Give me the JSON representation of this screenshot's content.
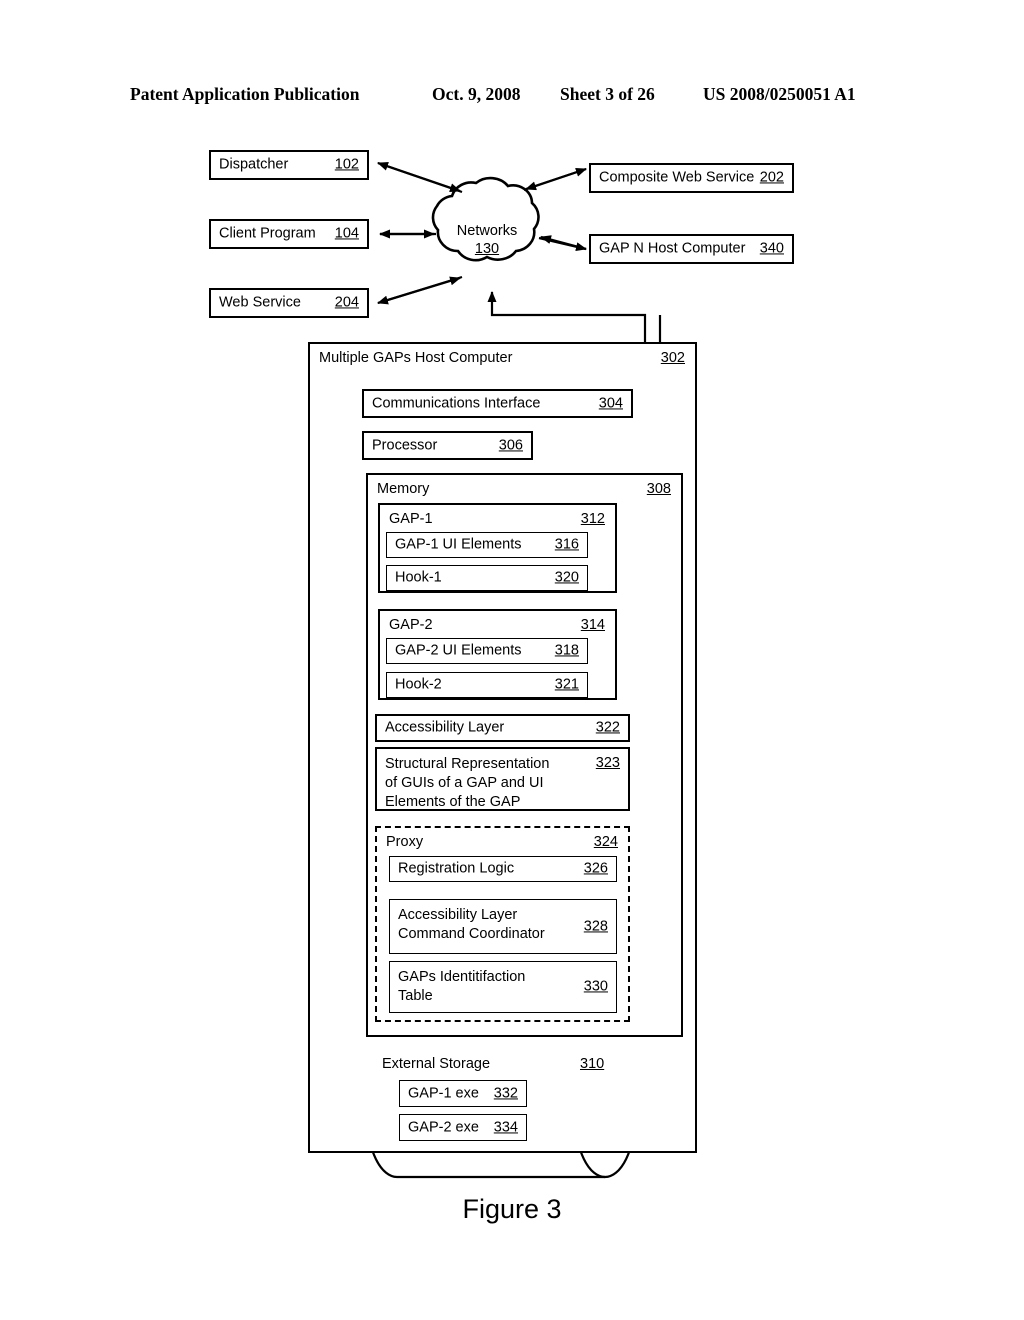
{
  "header": {
    "publication": "Patent Application Publication",
    "date": "Oct. 9, 2008",
    "sheet": "Sheet 3 of 26",
    "number": "US 2008/0250051 A1"
  },
  "figure": {
    "caption": "Figure 3",
    "cloud": {
      "label": "Networks",
      "ref": "130"
    },
    "left_nodes": [
      {
        "label": "Dispatcher",
        "ref": "102"
      },
      {
        "label": "Client Program",
        "ref": "104"
      },
      {
        "label": "Web Service",
        "ref": "204"
      }
    ],
    "right_nodes": [
      {
        "label": "Composite Web Service",
        "ref": "202"
      },
      {
        "label": "GAP N Host Computer",
        "ref": "340"
      }
    ],
    "host": {
      "label": "Multiple GAPs Host Computer",
      "ref": "302",
      "comm_interface": {
        "label": "Communications Interface",
        "ref": "304"
      },
      "processor": {
        "label": "Processor",
        "ref": "306"
      },
      "memory": {
        "label": "Memory",
        "ref": "308",
        "gap1": {
          "label": "GAP-1",
          "ref": "312",
          "ui_elements": {
            "label": "GAP-1 UI Elements",
            "ref": "316"
          },
          "hook": {
            "label": "Hook-1",
            "ref": "320"
          }
        },
        "gap2": {
          "label": "GAP-2",
          "ref": "314",
          "ui_elements": {
            "label": "GAP-2 UI Elements",
            "ref": "318"
          },
          "hook": {
            "label": "Hook-2",
            "ref": "321"
          }
        },
        "accessibility_layer": {
          "label": "Accessibility Layer",
          "ref": "322"
        },
        "structural_representation": {
          "label": "Structural Representation of GUIs of a GAP and UI Elements of the GAP",
          "ref": "323"
        },
        "proxy": {
          "label": "Proxy",
          "ref": "324",
          "registration_logic": {
            "label": "Registration Logic",
            "ref": "326"
          },
          "command_coordinator": {
            "label": "Accessibility Layer Command Coordinator",
            "ref": "328"
          },
          "identification_table": {
            "label": "GAPs Identitifaction Table",
            "ref": "330"
          }
        }
      },
      "external_storage": {
        "label": "External Storage",
        "ref": "310",
        "gap1_exe": {
          "label": "GAP-1 exe",
          "ref": "332"
        },
        "gap2_exe": {
          "label": "GAP-2 exe",
          "ref": "334"
        }
      }
    }
  },
  "colors": {
    "ink": "#000000",
    "paper": "#ffffff"
  }
}
